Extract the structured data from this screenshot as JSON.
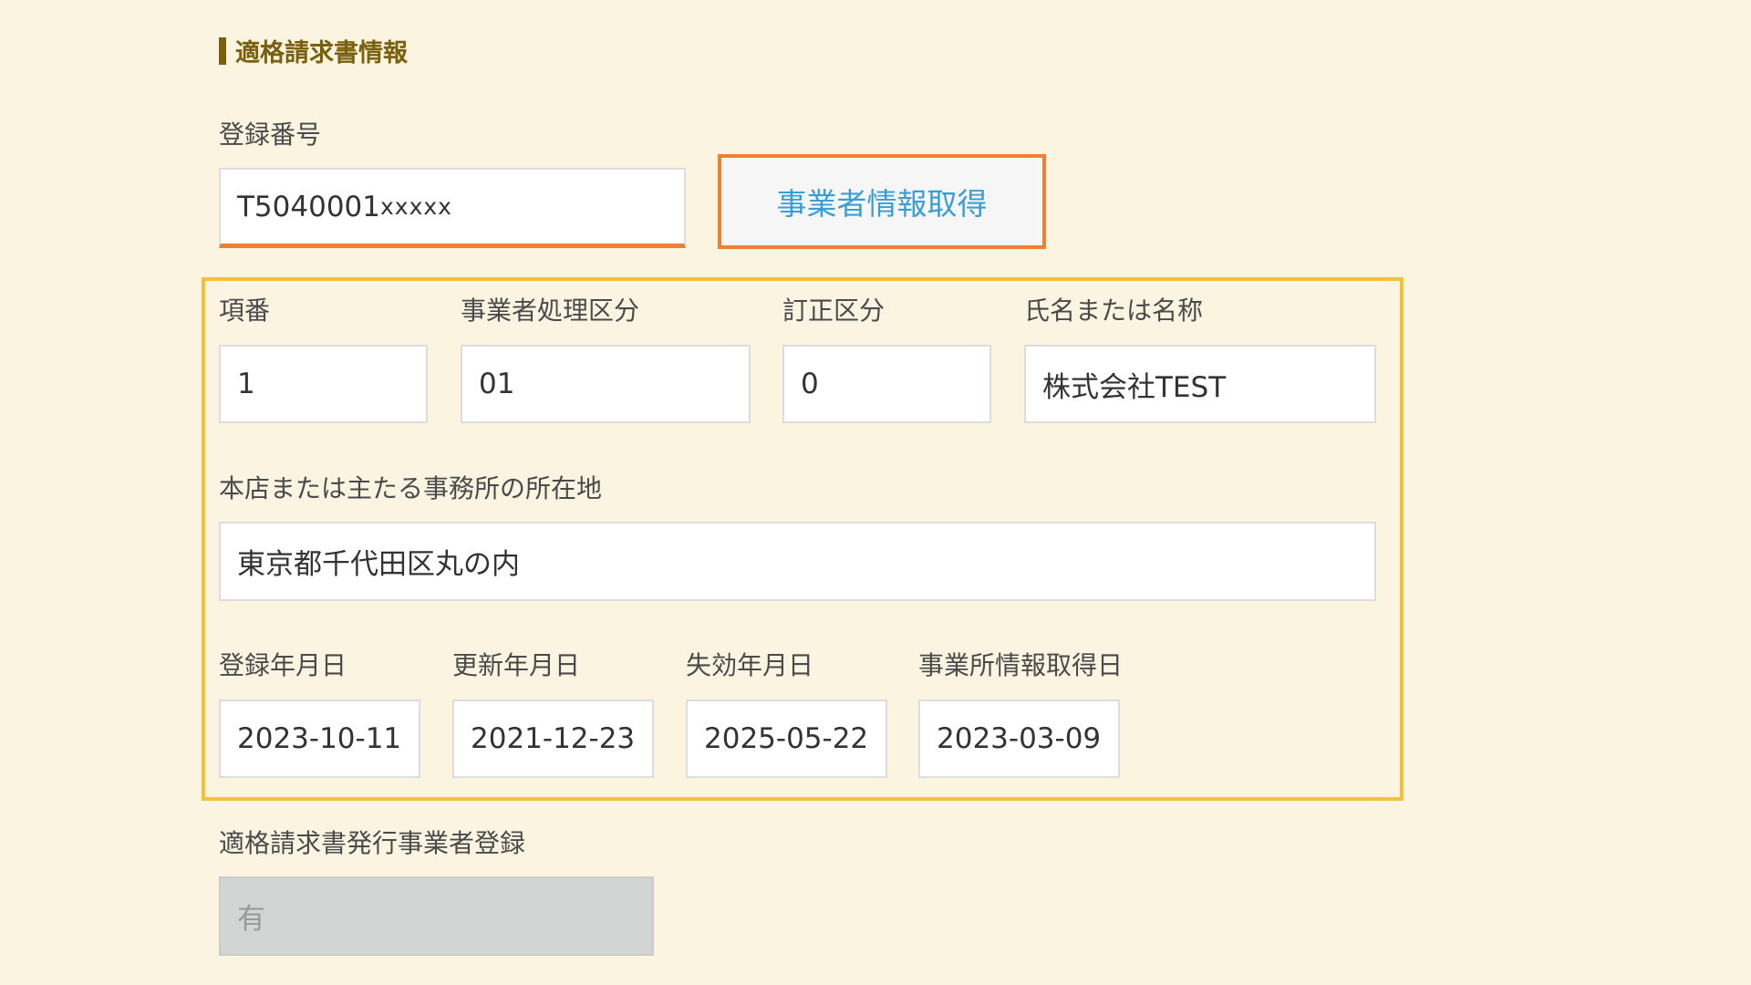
{
  "section": {
    "title": "適格請求書情報"
  },
  "registration": {
    "label": "登録番号",
    "value_prefix": "T5040001",
    "value_masked": "xxxxx",
    "fetch_button": "事業者情報取得"
  },
  "details": {
    "item_no": {
      "label": "項番",
      "value": "1"
    },
    "business_type": {
      "label": "事業者処理区分",
      "value": "01"
    },
    "correction": {
      "label": "訂正区分",
      "value": "0"
    },
    "name": {
      "label": "氏名または名称",
      "value": "株式会社TEST"
    },
    "address": {
      "label": "本店または主たる事務所の所在地",
      "value": "東京都千代田区丸の内"
    },
    "registered_date": {
      "label": "登録年月日",
      "value": "2023-10-11"
    },
    "updated_date": {
      "label": "更新年月日",
      "value": "2021-12-23"
    },
    "expired_date": {
      "label": "失効年月日",
      "value": "2025-05-22"
    },
    "fetched_date": {
      "label": "事業所情報取得日",
      "value": "2023-03-09"
    }
  },
  "issuer_registration": {
    "label": "適格請求書発行事業者登録",
    "value": "有"
  },
  "colors": {
    "background": "#faf4e1",
    "accent_orange": "#f07f2f",
    "highlight_yellow": "#f3c235",
    "title_brown": "#7a5f0c",
    "button_text_blue": "#3a9ed6"
  }
}
